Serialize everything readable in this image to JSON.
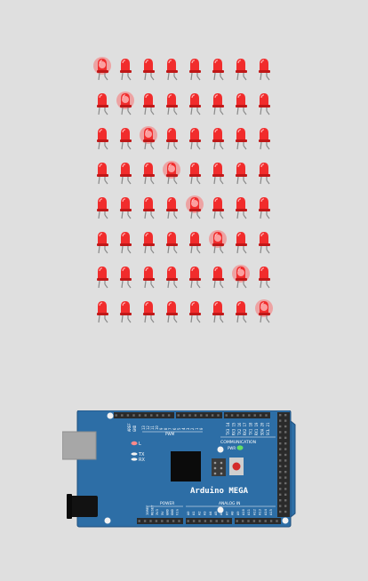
{
  "led_matrix": {
    "rows": 8,
    "cols": 8,
    "lit_diagonal": [
      0,
      1,
      2,
      3,
      4,
      5,
      6,
      7
    ],
    "colors": {
      "led_body": "#f12c2c",
      "led_dark": "#c01818",
      "glow": "#ff5a5a",
      "leg": "#8a8a8a"
    }
  },
  "board": {
    "name": "Arduino MEGA",
    "colors": {
      "pcb": "#2d6ea6",
      "pcb_edge": "#1e4f7c",
      "header": "#2a2a2a",
      "silk": "#ffffff",
      "power_led": "#64e064"
    },
    "labels": {
      "aref": "AREF",
      "gnd": "GND",
      "pwm_top": [
        "13",
        "12",
        "11",
        "10",
        "9",
        "8",
        "7",
        "6",
        "5",
        "4",
        "3",
        "2",
        "1",
        "0"
      ],
      "comm_pins": [
        "TX3 14",
        "RX3 15",
        "TX2 16",
        "RX2 17",
        "TX1 18",
        "RX1 19",
        "SDA 20",
        "SCL 21"
      ],
      "pwm": "PWM",
      "tx": "TX",
      "rx": "RX",
      "l": "L",
      "communication": "COMMUNICATION",
      "pwr": "PWR",
      "power": "POWER",
      "power_pins": [
        "IOREF",
        "RESET",
        "3V3",
        "5V",
        "GND",
        "GND",
        "Vin"
      ],
      "analog_in": "ANALOG IN",
      "analog_pins": [
        "A0",
        "A1",
        "A2",
        "A3",
        "A4",
        "A5",
        "A6",
        "A7",
        "A8",
        "A9",
        "A10",
        "A11",
        "A12",
        "A13",
        "A14",
        "A15"
      ]
    }
  }
}
